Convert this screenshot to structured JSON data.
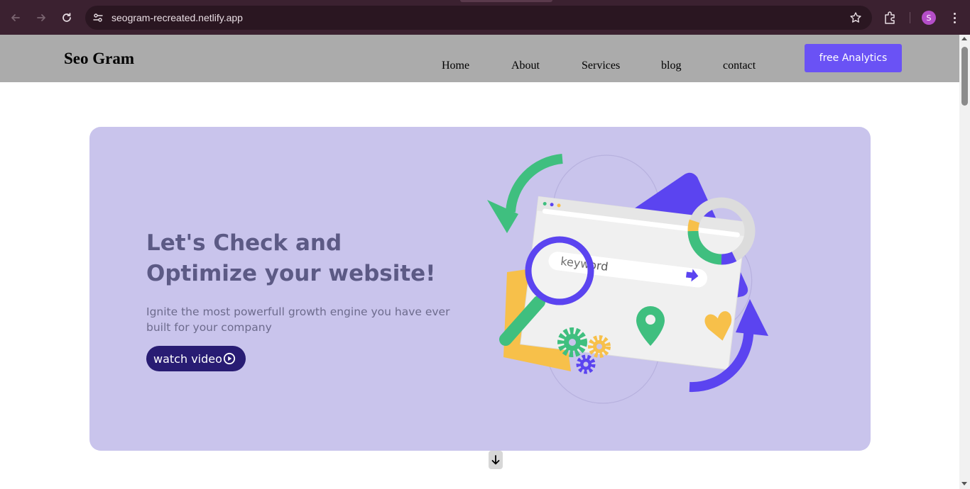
{
  "browser": {
    "url": "seogram-recreated.netlify.app",
    "profile_initial": "S",
    "icons": [
      "back-arrow-icon",
      "forward-arrow-icon",
      "reload-icon",
      "site-info-icon",
      "bookmark-star-icon",
      "extensions-icon",
      "kebab-menu-icon"
    ]
  },
  "header": {
    "brand": "Seo Gram",
    "nav": [
      "Home",
      "About",
      "Services",
      "blog",
      "contact"
    ],
    "cta": "free Analytics"
  },
  "hero": {
    "title": "Let's Check and Optimize your website!",
    "subtitle": "Ignite the most powerfull growth engine you have ever built for your company",
    "button": "watch video",
    "illustration_keyword": "keyword"
  },
  "colors": {
    "chrome": "#3b2130",
    "header_bg": "#ababab",
    "hero_bg": "#c9c4ec",
    "accent": "#6a52f5",
    "button_dark": "#281c73",
    "green": "#3fbf7f",
    "yellow": "#f7c04a"
  }
}
